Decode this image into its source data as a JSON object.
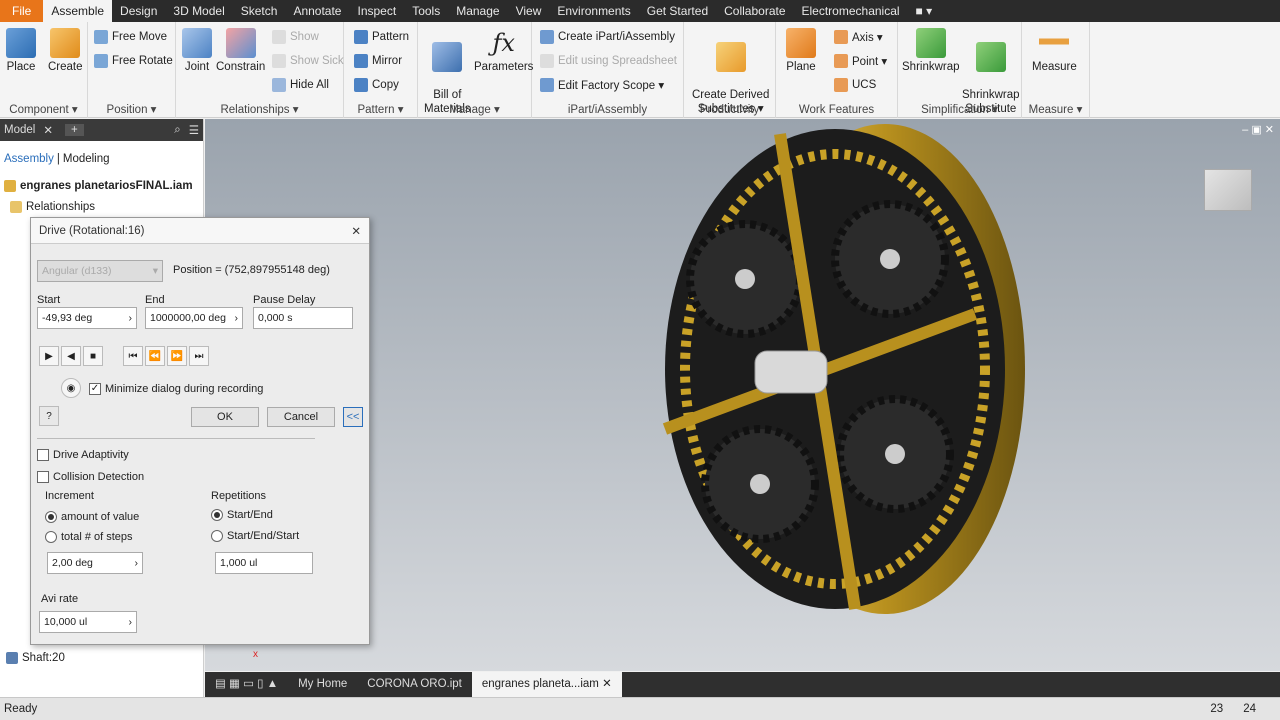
{
  "menu": {
    "tabs": [
      "File",
      "Assemble",
      "Design",
      "3D Model",
      "Sketch",
      "Annotate",
      "Inspect",
      "Tools",
      "Manage",
      "View",
      "Environments",
      "Get Started",
      "Collaborate",
      "Electromechanical"
    ],
    "active": "Assemble"
  },
  "ribbon": {
    "component": {
      "label": "Component ▾",
      "place": "Place",
      "create": "Create"
    },
    "position": {
      "label": "Position ▾",
      "free_move": "Free Move",
      "free_rotate": "Free Rotate"
    },
    "relationships": {
      "label": "Relationships ▾",
      "joint": "Joint",
      "constrain": "Constrain",
      "show": "Show",
      "show_sick": "Show Sick",
      "hide_all": "Hide All"
    },
    "pattern": {
      "label": "Pattern ▾",
      "pattern": "Pattern",
      "mirror": "Mirror",
      "copy": "Copy"
    },
    "manage": {
      "label": "Manage ▾",
      "bom": "Bill of\nMaterials",
      "parameters": "Parameters"
    },
    "ipart": {
      "label": "iPart/iAssembly",
      "create": "Create iPart/iAssembly",
      "edit_spreadsheet": "Edit using Spreadsheet",
      "edit_factory": "Edit Factory Scope ▾"
    },
    "productivity": {
      "label": "Productivity",
      "create_derived": "Create Derived\nSubstitutes ▾"
    },
    "work_features": {
      "label": "Work Features",
      "plane": "Plane",
      "axis": "Axis ▾",
      "point": "Point ▾",
      "ucs": "UCS"
    },
    "simplification": {
      "label": "Simplification ▾",
      "shrinkwrap": "Shrinkwrap",
      "shrinkwrap_sub": "Shrinkwrap\nSubstitute"
    },
    "measure": {
      "label": "Measure ▾",
      "measure": "Measure"
    }
  },
  "browser": {
    "tab": "Model",
    "add": "+",
    "mode_assembly": "Assembly",
    "mode_modeling": "Modeling",
    "root": "engranes planetariosFINAL.iam",
    "relationships": "Relationships",
    "last_item": "Shaft:20"
  },
  "dialog": {
    "title": "Drive (Rotational:16)",
    "angular": "Angular (d133)",
    "position": "Position = (752,897955148 deg)",
    "start_label": "Start",
    "start_value": "-49,93 deg",
    "end_label": "End",
    "end_value": "1000000,00 deg",
    "pause_label": "Pause Delay",
    "pause_value": "0,000 s",
    "minimize": "Minimize dialog during recording",
    "ok": "OK",
    "cancel": "Cancel",
    "collapse": "<<",
    "drive_adaptivity": "Drive Adaptivity",
    "collision": "Collision Detection",
    "increment_label": "Increment",
    "amount": "amount of value",
    "total_steps": "total # of steps",
    "increment_value": "2,00 deg",
    "repetitions_label": "Repetitions",
    "start_end": "Start/End",
    "start_end_start": "Start/End/Start",
    "repetitions_value": "1,000 ul",
    "avi_label": "Avi rate",
    "avi_value": "10,000 ul"
  },
  "doc_tabs": {
    "home": "My Home",
    "corona": "CORONA ORO.ipt",
    "engranes": "engranes planeta...iam"
  },
  "status": {
    "text": "Ready",
    "n1": "23",
    "n2": "24"
  },
  "colors": {
    "accent": "#e8751a",
    "gold": "#c9a227",
    "ring_dark": "#1e1e1e"
  }
}
